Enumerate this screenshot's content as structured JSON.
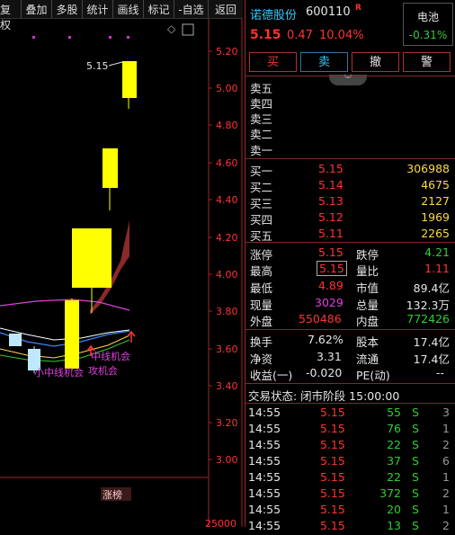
{
  "toolbar": {
    "buttons": [
      "复权",
      "叠加",
      "多股",
      "统计",
      "画线",
      "标记",
      "-自选",
      "返回"
    ]
  },
  "chart": {
    "y_ticks": [
      "5.20",
      "5.00",
      "4.80",
      "4.60",
      "4.40",
      "4.20",
      "4.00",
      "3.80",
      "3.60",
      "3.40",
      "3.20",
      "3.00"
    ],
    "high_label": "5.15",
    "signal_label_1": "中线机会",
    "signal_label_2": "小中线机会",
    "signal_label_3": "攻机会",
    "bottom_tag": "涨榜",
    "bottom_value": "25000",
    "diamond": "◇"
  },
  "stock": {
    "name": "诺德股份",
    "code": "600110",
    "flag": "R",
    "price": "5.15",
    "change": "0.47",
    "pct": "10.04%",
    "sector": "电池",
    "sector_pct": "-0.31%"
  },
  "actions": [
    "买",
    "卖",
    "撤",
    "警"
  ],
  "asks": [
    {
      "label": "卖五",
      "price": "",
      "vol": ""
    },
    {
      "label": "卖四",
      "price": "",
      "vol": ""
    },
    {
      "label": "卖三",
      "price": "",
      "vol": ""
    },
    {
      "label": "卖二",
      "price": "",
      "vol": ""
    },
    {
      "label": "卖一",
      "price": "",
      "vol": ""
    }
  ],
  "bids": [
    {
      "label": "买一",
      "price": "5.15",
      "vol": "306988"
    },
    {
      "label": "买二",
      "price": "5.14",
      "vol": "4675"
    },
    {
      "label": "买三",
      "price": "5.13",
      "vol": "2127"
    },
    {
      "label": "买四",
      "price": "5.12",
      "vol": "1969"
    },
    {
      "label": "买五",
      "price": "5.11",
      "vol": "2265"
    }
  ],
  "stats": [
    {
      "l1": "涨停",
      "v1": "5.15",
      "l2": "跌停",
      "v2": "4.21"
    },
    {
      "l1": "最高",
      "v1": "5.15",
      "l2": "量比",
      "v2": "1.11"
    },
    {
      "l1": "最低",
      "v1": "4.89",
      "l2": "市值",
      "v2": "89.4亿"
    },
    {
      "l1": "现量",
      "v1": "3029",
      "l2": "总量",
      "v2": "132.3万"
    },
    {
      "l1": "外盘",
      "v1": "550486",
      "l2": "内盘",
      "v2": "772426"
    }
  ],
  "fund": [
    {
      "l1": "换手",
      "v1": "7.62%",
      "l2": "股本",
      "v2": "17.4亿"
    },
    {
      "l1": "净资",
      "v1": "3.31",
      "l2": "流通",
      "v2": "17.4亿"
    },
    {
      "l1": "收益(一)",
      "v1": "-0.020",
      "l2": "PE(动)",
      "v2": "--"
    }
  ],
  "trade_status": "交易状态: 闭市阶段 15:00:00",
  "ticks": [
    {
      "t": "14:55",
      "p": "5.15",
      "v": "55",
      "s": "S",
      "n": "3"
    },
    {
      "t": "14:55",
      "p": "5.15",
      "v": "76",
      "s": "S",
      "n": "1"
    },
    {
      "t": "14:55",
      "p": "5.15",
      "v": "22",
      "s": "S",
      "n": "2"
    },
    {
      "t": "14:55",
      "p": "5.15",
      "v": "37",
      "s": "S",
      "n": "6"
    },
    {
      "t": "14:55",
      "p": "5.15",
      "v": "22",
      "s": "S",
      "n": "1"
    },
    {
      "t": "14:55",
      "p": "5.15",
      "v": "372",
      "s": "S",
      "n": "2"
    },
    {
      "t": "14:55",
      "p": "5.15",
      "v": "20",
      "s": "S",
      "n": "1"
    },
    {
      "t": "14:55",
      "p": "5.15",
      "v": "13",
      "s": "S",
      "n": "2"
    }
  ]
}
